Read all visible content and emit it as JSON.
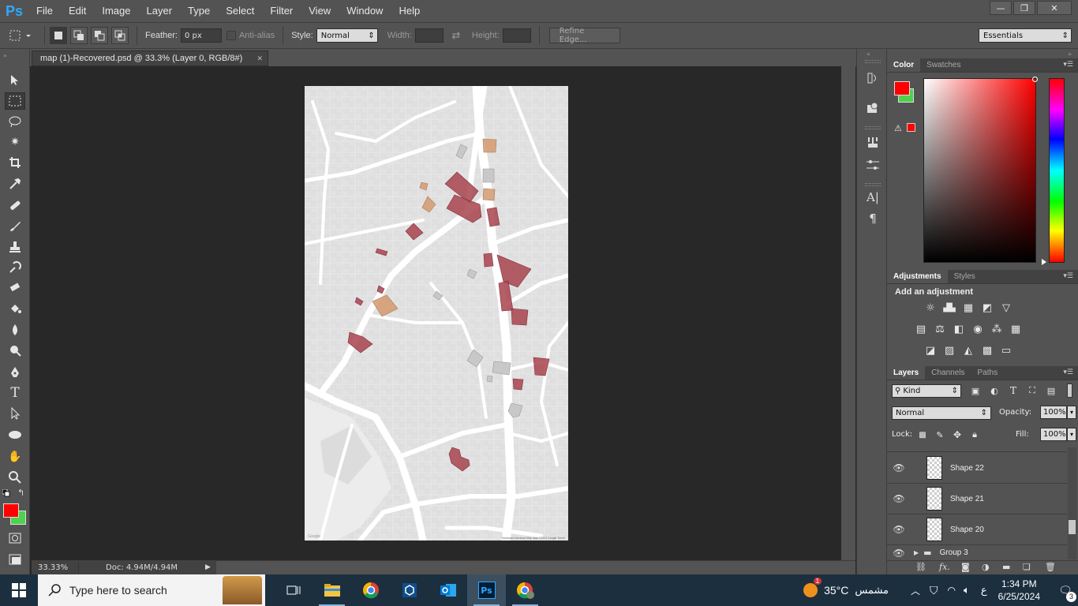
{
  "app": {
    "logo": "Ps"
  },
  "menu": [
    "File",
    "Edit",
    "Image",
    "Layer",
    "Type",
    "Select",
    "Filter",
    "View",
    "Window",
    "Help"
  ],
  "window_controls": {
    "minimize": "—",
    "restore": "❐",
    "close": "✕"
  },
  "options": {
    "feather_label": "Feather:",
    "feather_value": "0 px",
    "antialias_label": "Anti-alias",
    "style_label": "Style:",
    "style_value": "Normal",
    "width_label": "Width:",
    "height_label": "Height:",
    "refine_label": "Refine Edge...",
    "workspace": "Essentials"
  },
  "document": {
    "tab_title": "map (1)-Recovered.psd @ 33.3% (Layer 0, RGB/8#)",
    "tab_close": "✕",
    "zoom": "33.33%",
    "doc_size": "Doc: 4.94M/4.94M",
    "map_footer_left": "Google",
    "map_footer_right": "Keyboard shortcuts   Map data ©2024 Google   Terms"
  },
  "colors": {
    "foreground": "#ff0000",
    "background": "#4ed14e",
    "building_red": "#a8434f",
    "building_tan": "#d49a6e",
    "building_grey": "#b8b8b8"
  },
  "panels": {
    "color_tabs": [
      "Color",
      "Swatches"
    ],
    "adjust_tabs": [
      "Adjustments",
      "Styles"
    ],
    "adjust_heading": "Add an adjustment",
    "layers_tabs": [
      "Layers",
      "Channels",
      "Paths"
    ],
    "kind_filter": "Kind",
    "blend_mode": "Normal",
    "opacity_label": "Opacity:",
    "opacity_value": "100%",
    "lock_label": "Lock:",
    "fill_label": "Fill:",
    "fill_value": "100%",
    "layers": [
      {
        "name": "Shape 22"
      },
      {
        "name": "Shape 21"
      },
      {
        "name": "Shape 20"
      },
      {
        "name": "Group 3"
      }
    ],
    "bottom_fx": "fx."
  },
  "taskbar": {
    "search_placeholder": "Type here to search",
    "weather_temp": "35°C",
    "weather_text": "مشمس",
    "time": "1:34 PM",
    "date": "6/25/2024",
    "lang": "ع",
    "notifications": "3",
    "weather_badge": "1"
  }
}
